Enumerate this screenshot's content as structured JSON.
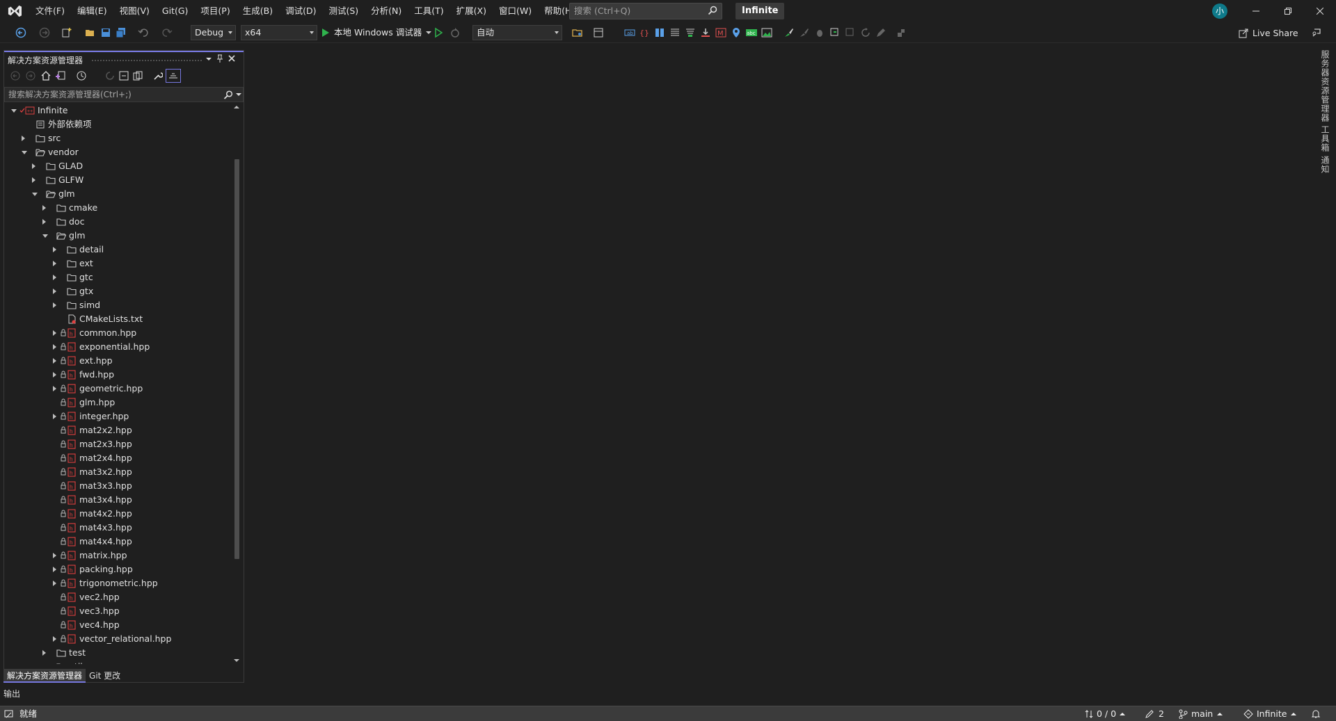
{
  "app": {
    "menus": [
      "文件(F)",
      "编辑(E)",
      "视图(V)",
      "Git(G)",
      "项目(P)",
      "生成(B)",
      "调试(D)",
      "测试(S)",
      "分析(N)",
      "工具(T)",
      "扩展(X)",
      "窗口(W)",
      "帮助(H)"
    ],
    "search_placeholder": "搜索 (Ctrl+Q)",
    "solution_name": "Infinite",
    "avatar_initial": "小"
  },
  "toolbar": {
    "configuration": "Debug",
    "platform": "x64",
    "run_label": "本地 Windows 调试器",
    "auto_label": "自动",
    "live_share": "Live Share"
  },
  "right_strip": {
    "tabs": [
      "服务器资源管理器",
      "工具箱",
      "通知"
    ]
  },
  "solution_explorer": {
    "title": "解决方案资源管理器",
    "search_placeholder": "搜索解决方案资源管理器(Ctrl+;)",
    "tree": [
      {
        "label": "Infinite",
        "depth": 0,
        "expander": "open",
        "icon": "project-icon"
      },
      {
        "label": "外部依赖项",
        "depth": 1,
        "expander": "none",
        "icon": "dependencies-icon"
      },
      {
        "label": "src",
        "depth": 1,
        "expander": "closed",
        "icon": "folder-icon"
      },
      {
        "label": "vendor",
        "depth": 1,
        "expander": "open",
        "icon": "folder-open-icon"
      },
      {
        "label": "GLAD",
        "depth": 2,
        "expander": "closed",
        "icon": "folder-icon"
      },
      {
        "label": "GLFW",
        "depth": 2,
        "expander": "closed",
        "icon": "folder-icon"
      },
      {
        "label": "glm",
        "depth": 2,
        "expander": "open",
        "icon": "folder-open-icon"
      },
      {
        "label": "cmake",
        "depth": 3,
        "expander": "closed",
        "icon": "folder-icon"
      },
      {
        "label": "doc",
        "depth": 3,
        "expander": "closed",
        "icon": "folder-icon"
      },
      {
        "label": "glm",
        "depth": 3,
        "expander": "open",
        "icon": "folder-open-icon"
      },
      {
        "label": "detail",
        "depth": 4,
        "expander": "closed",
        "icon": "folder-icon"
      },
      {
        "label": "ext",
        "depth": 4,
        "expander": "closed",
        "icon": "folder-icon"
      },
      {
        "label": "gtc",
        "depth": 4,
        "expander": "closed",
        "icon": "folder-icon"
      },
      {
        "label": "gtx",
        "depth": 4,
        "expander": "closed",
        "icon": "folder-icon"
      },
      {
        "label": "simd",
        "depth": 4,
        "expander": "closed",
        "icon": "folder-icon"
      },
      {
        "label": "CMakeLists.txt",
        "depth": 4,
        "expander": "none",
        "icon": "text-file-icon"
      },
      {
        "label": "common.hpp",
        "depth": 4,
        "expander": "closed",
        "icon": "header-file-icon",
        "lock": true
      },
      {
        "label": "exponential.hpp",
        "depth": 4,
        "expander": "closed",
        "icon": "header-file-icon",
        "lock": true
      },
      {
        "label": "ext.hpp",
        "depth": 4,
        "expander": "closed",
        "icon": "header-file-icon",
        "lock": true
      },
      {
        "label": "fwd.hpp",
        "depth": 4,
        "expander": "closed",
        "icon": "header-file-icon",
        "lock": true
      },
      {
        "label": "geometric.hpp",
        "depth": 4,
        "expander": "closed",
        "icon": "header-file-icon",
        "lock": true
      },
      {
        "label": "glm.hpp",
        "depth": 4,
        "expander": "none",
        "icon": "header-file-icon",
        "lock": true
      },
      {
        "label": "integer.hpp",
        "depth": 4,
        "expander": "closed",
        "icon": "header-file-icon",
        "lock": true
      },
      {
        "label": "mat2x2.hpp",
        "depth": 4,
        "expander": "none",
        "icon": "header-file-icon",
        "lock": true
      },
      {
        "label": "mat2x3.hpp",
        "depth": 4,
        "expander": "none",
        "icon": "header-file-icon",
        "lock": true
      },
      {
        "label": "mat2x4.hpp",
        "depth": 4,
        "expander": "none",
        "icon": "header-file-icon",
        "lock": true
      },
      {
        "label": "mat3x2.hpp",
        "depth": 4,
        "expander": "none",
        "icon": "header-file-icon",
        "lock": true
      },
      {
        "label": "mat3x3.hpp",
        "depth": 4,
        "expander": "none",
        "icon": "header-file-icon",
        "lock": true
      },
      {
        "label": "mat3x4.hpp",
        "depth": 4,
        "expander": "none",
        "icon": "header-file-icon",
        "lock": true
      },
      {
        "label": "mat4x2.hpp",
        "depth": 4,
        "expander": "none",
        "icon": "header-file-icon",
        "lock": true
      },
      {
        "label": "mat4x3.hpp",
        "depth": 4,
        "expander": "none",
        "icon": "header-file-icon",
        "lock": true
      },
      {
        "label": "mat4x4.hpp",
        "depth": 4,
        "expander": "none",
        "icon": "header-file-icon",
        "lock": true
      },
      {
        "label": "matrix.hpp",
        "depth": 4,
        "expander": "closed",
        "icon": "header-file-icon",
        "lock": true
      },
      {
        "label": "packing.hpp",
        "depth": 4,
        "expander": "closed",
        "icon": "header-file-icon",
        "lock": true
      },
      {
        "label": "trigonometric.hpp",
        "depth": 4,
        "expander": "closed",
        "icon": "header-file-icon",
        "lock": true
      },
      {
        "label": "vec2.hpp",
        "depth": 4,
        "expander": "none",
        "icon": "header-file-icon",
        "lock": true
      },
      {
        "label": "vec3.hpp",
        "depth": 4,
        "expander": "none",
        "icon": "header-file-icon",
        "lock": true
      },
      {
        "label": "vec4.hpp",
        "depth": 4,
        "expander": "none",
        "icon": "header-file-icon",
        "lock": true
      },
      {
        "label": "vector_relational.hpp",
        "depth": 4,
        "expander": "closed",
        "icon": "header-file-icon",
        "lock": true
      },
      {
        "label": "test",
        "depth": 3,
        "expander": "closed",
        "icon": "folder-icon"
      },
      {
        "label": "util",
        "depth": 3,
        "expander": "closed",
        "icon": "folder-icon"
      }
    ],
    "tabs": [
      "解决方案资源管理器",
      "Git 更改"
    ],
    "active_tab": 0
  },
  "output_tab": "输出",
  "status": {
    "ready": "就绪",
    "sync": "0 / 0",
    "edits": "2",
    "branch": "main",
    "repo": "Infinite"
  },
  "colors": {
    "accent": "#7778e0",
    "header_icon_red": "#e04040",
    "folder_outline": "#c8c8c8",
    "run_green": "#2fb34d"
  }
}
